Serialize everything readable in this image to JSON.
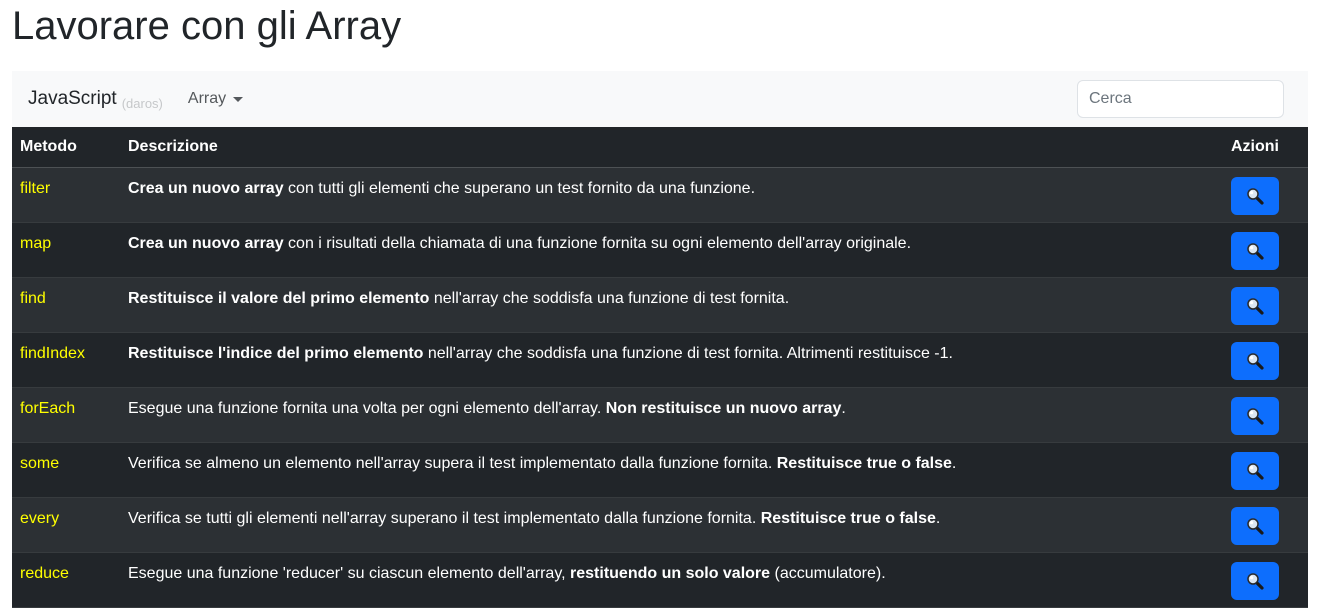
{
  "page": {
    "title": "Lavorare con gli Array"
  },
  "navbar": {
    "brand": "JavaScript",
    "brand_author": "(daros)",
    "dropdown_label": "Array",
    "search_placeholder": "Cerca"
  },
  "table": {
    "headers": {
      "method": "Metodo",
      "description": "Descrizione",
      "actions": "Azioni"
    },
    "rows": [
      {
        "method": "filter",
        "parts": [
          {
            "b": true,
            "t": "Crea un nuovo array"
          },
          {
            "b": false,
            "t": " con tutti gli elementi che superano un test fornito da una funzione."
          }
        ]
      },
      {
        "method": "map",
        "parts": [
          {
            "b": true,
            "t": "Crea un nuovo array"
          },
          {
            "b": false,
            "t": " con i risultati della chiamata di una funzione fornita su ogni elemento dell'array originale."
          }
        ]
      },
      {
        "method": "find",
        "parts": [
          {
            "b": true,
            "t": "Restituisce il valore del primo elemento"
          },
          {
            "b": false,
            "t": " nell'array che soddisfa una funzione di test fornita."
          }
        ]
      },
      {
        "method": "findIndex",
        "parts": [
          {
            "b": true,
            "t": "Restituisce l'indice del primo elemento"
          },
          {
            "b": false,
            "t": " nell'array che soddisfa una funzione di test fornita. Altrimenti restituisce -1."
          }
        ]
      },
      {
        "method": "forEach",
        "parts": [
          {
            "b": false,
            "t": "Esegue una funzione fornita una volta per ogni elemento dell'array. "
          },
          {
            "b": true,
            "t": "Non restituisce un nuovo array"
          },
          {
            "b": false,
            "t": "."
          }
        ]
      },
      {
        "method": "some",
        "parts": [
          {
            "b": false,
            "t": "Verifica se almeno un elemento nell'array supera il test implementato dalla funzione fornita. "
          },
          {
            "b": true,
            "t": "Restituisce true o false"
          },
          {
            "b": false,
            "t": "."
          }
        ]
      },
      {
        "method": "every",
        "parts": [
          {
            "b": false,
            "t": "Verifica se tutti gli elementi nell'array superano il test implementato dalla funzione fornita. "
          },
          {
            "b": true,
            "t": "Restituisce true o false"
          },
          {
            "b": false,
            "t": "."
          }
        ]
      },
      {
        "method": "reduce",
        "parts": [
          {
            "b": false,
            "t": "Esegue una funzione 'reducer' su ciascun elemento dell'array, "
          },
          {
            "b": true,
            "t": "restituendo un solo valore"
          },
          {
            "b": false,
            "t": " (accumulatore)."
          }
        ]
      }
    ],
    "action_icon": "magnifier-icon"
  },
  "colors": {
    "method_text": "#ffff00",
    "button_bg": "#0d6efd",
    "table_dark": "#212529",
    "table_striped": "#2c3034",
    "navbar_bg": "#f8f9fa"
  }
}
